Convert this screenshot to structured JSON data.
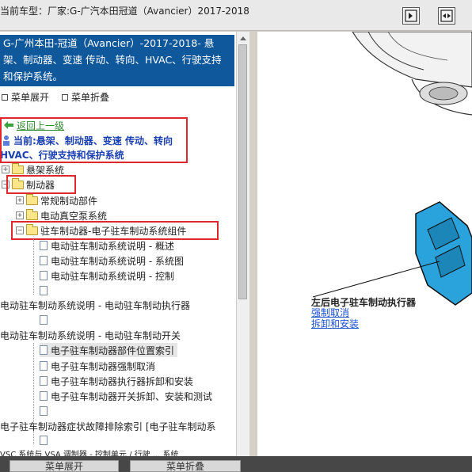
{
  "topbar": {
    "title": "当前车型：厂家:G-广汽本田冠道（Avancier）2017-2018"
  },
  "header": {
    "title": "G-广州本田-冠道（Avancier）-2017-2018- 悬架、制动器、变速 传动、转向、HVAC、行驶支持和保护系统。"
  },
  "menu": {
    "expand": "菜单展开",
    "collapse": "菜单折叠"
  },
  "nav": {
    "back": "返回上一级",
    "current_line1": "当前:悬架、制动器、变速 传动、转向",
    "current_line2": "HVAC、行驶支持和保护系统"
  },
  "tree": {
    "suspension": "悬架系统",
    "brakes": "制动器",
    "regular_brake_parts": "常规制动部件",
    "electric_vacuum_pump": "电动真空泵系统",
    "parking_brake": "驻车制动器-电子驻车制动系统组件",
    "epb_overview": "电动驻车制动系统说明 - 概述",
    "epb_diagram": "电动驻车制动系统说明 - 系统图",
    "epb_control": "电动驻车制动系统说明 - 控制",
    "epb_actuator": "电动驻车制动系统说明 - 电动驻车制动执行器",
    "epb_switch": "电动驻车制动系统说明 - 电动驻车制动开关",
    "epb_component_index": "电子驻车制动器部件位置索引",
    "epb_forced_release": "电子驻车制动器强制取消",
    "epb_actuator_remove": "电子驻车制动器执行器拆卸和安装",
    "epb_switch_remove": "电子驻车制动器开关拆卸、安装和测试",
    "epb_symptom_index": "电子驻车制动器症状故障排除索引 [电子驻车制动系",
    "cut_off_row": "VSC 系统与 VSA 调制器 - 控制单元 / 行驶 ... 系统"
  },
  "illustration": {
    "label": "左后电子驻车制动执行器",
    "link1": "强制取消",
    "link2": "拆卸和安装"
  },
  "bottom": {
    "btn1": "菜单展开",
    "btn2": "菜单折叠"
  },
  "colors": {
    "header_bg": "#10589c",
    "highlight_box": "#e0272d",
    "link_blue": "#1a4fd0",
    "back_green": "#2e8b2e"
  }
}
